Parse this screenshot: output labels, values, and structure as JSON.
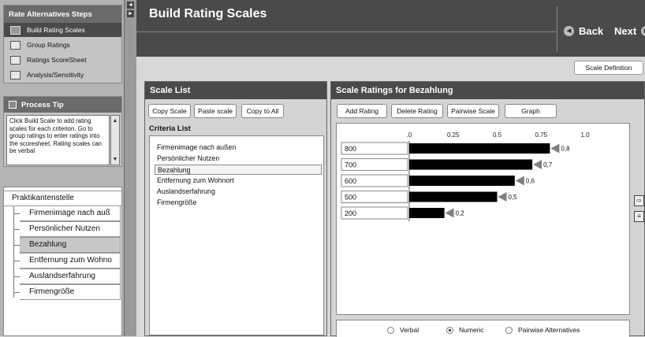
{
  "sidebar": {
    "steps_title": "Rate Alternatives Steps",
    "steps": [
      {
        "label": "Build Rating Scales",
        "icon": "build-scales-icon",
        "active": true
      },
      {
        "label": "Group Ratings",
        "icon": "group-ratings-icon",
        "active": false
      },
      {
        "label": "Ratings ScoreSheet",
        "icon": "scoresheet-icon",
        "active": false
      },
      {
        "label": "Analysis/Sensitivity",
        "icon": "analysis-icon",
        "active": false
      }
    ],
    "tip_title": "Process Tip",
    "tip_text": "Click Build Scale to add rating scales for each criterion.  Go to group ratings to enter ratings into the scoresheet. Rating scales can be verbal",
    "tree_root": "Praktikantenstelle",
    "tree_items": [
      {
        "label": "Firmenimage nach auß",
        "selected": false
      },
      {
        "label": "Persönlicher Nutzen",
        "selected": false
      },
      {
        "label": "Bezahlung",
        "selected": true
      },
      {
        "label": "Entfernung zum Wohno",
        "selected": false
      },
      {
        "label": "Auslandserfahrung",
        "selected": false
      },
      {
        "label": "Firmengröße",
        "selected": false
      }
    ]
  },
  "splitter": {
    "collapse": "◄",
    "expand": "►"
  },
  "header": {
    "title": "Build Rating Scales",
    "back_label": "Back",
    "next_label": "Next",
    "back_glyph": "◄",
    "next_glyph": "►"
  },
  "scale_definition_label": "Scale Definition",
  "scale_list": {
    "title": "Scale List",
    "buttons": [
      "Copy Scale",
      "Paste scale",
      "Copy to All"
    ],
    "criteria_label": "Criteria List",
    "criteria": [
      {
        "label": "Firmenimage nach außen",
        "selected": false
      },
      {
        "label": "Persönlicher Nutzen",
        "selected": false
      },
      {
        "label": "Bezahlung",
        "selected": true
      },
      {
        "label": "Entfernung zum Wohnort",
        "selected": false
      },
      {
        "label": "Auslandserfahrung",
        "selected": false
      },
      {
        "label": "Firmengröße",
        "selected": false
      }
    ]
  },
  "ratings": {
    "title": "Scale Ratings for Bezahlung",
    "buttons": [
      "Add Rating",
      "Delete Rating",
      "Pairwise Scale",
      "Graph"
    ],
    "radios": [
      {
        "label": "Verbal",
        "checked": false
      },
      {
        "label": "Numeric",
        "checked": true
      },
      {
        "label": "Pairwise Alternatives",
        "checked": false
      }
    ]
  },
  "chart_data": {
    "type": "bar",
    "orientation": "horizontal",
    "categories": [
      "800",
      "700",
      "600",
      "500",
      "200"
    ],
    "values": [
      0.8,
      0.7,
      0.6,
      0.5,
      0.2
    ],
    "value_labels": [
      "0,8",
      "0,7",
      "0,6",
      "0,5",
      "0,2"
    ],
    "xticks": [
      {
        "value": 0,
        "label": ".0"
      },
      {
        "value": 0.25,
        "label": "0.25"
      },
      {
        "value": 0.5,
        "label": "0.5"
      },
      {
        "value": 0.75,
        "label": "0.75"
      },
      {
        "value": 1.0,
        "label": "1.0"
      }
    ],
    "xlim": [
      0,
      1
    ],
    "bar_color": "#000000",
    "marker_color": "#808080"
  },
  "side_icons": [
    "export-icon",
    "report-icon"
  ]
}
